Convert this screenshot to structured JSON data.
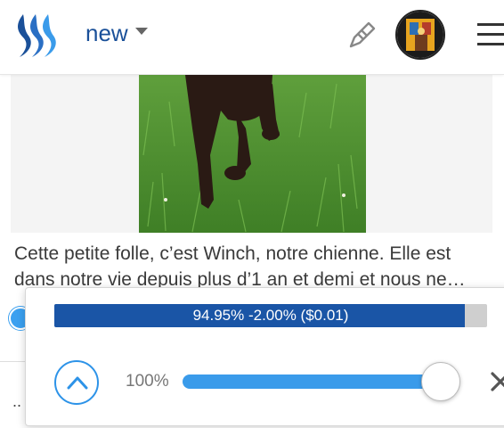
{
  "header": {
    "sort_label": "new",
    "logo_icon": "steemit-logo-icon",
    "pen_icon": "pen-icon",
    "menu_icon": "hamburger-menu-icon"
  },
  "post": {
    "summary": "Cette petite folle, c’est Winch, notre chienne. Elle est dans notre vie depuis plus d’1 an et demi et nous ne…",
    "bottom_dots": ".."
  },
  "vote_popup": {
    "progress_label": "94.95% -2.00% ($0.01)",
    "progress_fraction": 0.9495,
    "weight_label": "100%",
    "weight_fraction": 1.0
  },
  "colors": {
    "brand_blue": "#1a55a6",
    "accent_blue": "#3a9bea"
  }
}
